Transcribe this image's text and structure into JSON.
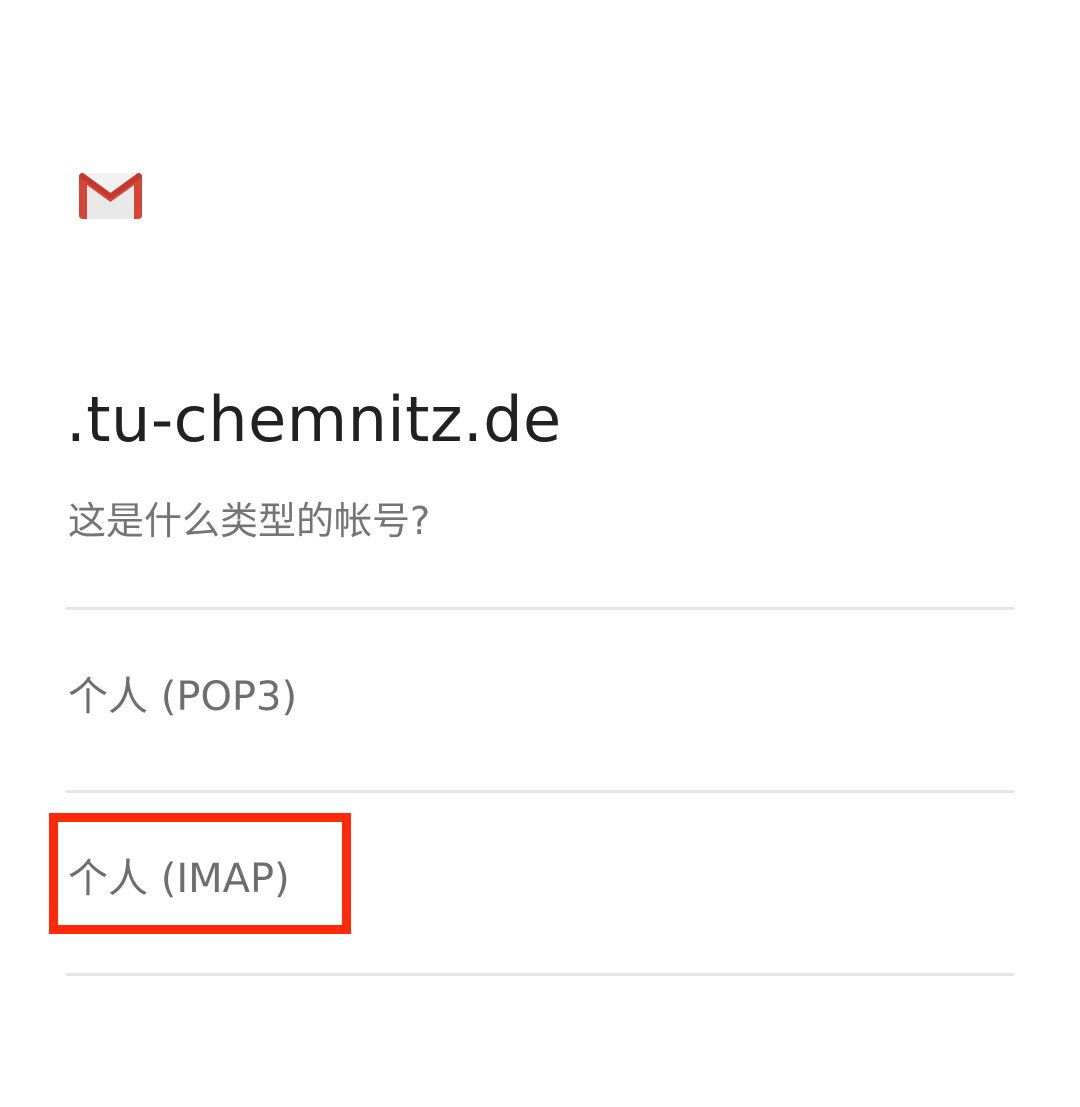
{
  "header": {
    "logo_icon": "gmail-icon",
    "domain": ".tu-chemnitz.de",
    "question": "这是什么类型的帐号?"
  },
  "options": [
    {
      "label": "个人 (POP3)"
    },
    {
      "label": "个人 (IMAP)",
      "highlighted": true
    }
  ],
  "colors": {
    "gmail_red": "#d44638",
    "highlight": "#ff2a0a",
    "text_primary": "#212121",
    "text_secondary": "#757575",
    "divider": "#e6e6e6"
  }
}
